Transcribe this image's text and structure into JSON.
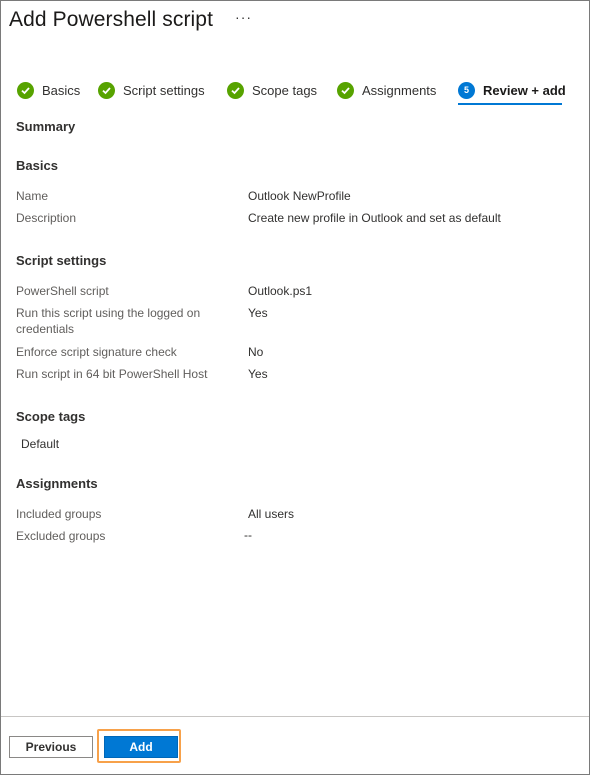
{
  "header": {
    "title": "Add Powershell script",
    "more_label": "···"
  },
  "steps": [
    {
      "label": "Basics",
      "status": "complete"
    },
    {
      "label": "Script settings",
      "status": "complete"
    },
    {
      "label": "Scope tags",
      "status": "complete"
    },
    {
      "label": "Assignments",
      "status": "complete"
    },
    {
      "label": "Review + add",
      "status": "current",
      "number": "5"
    }
  ],
  "summary": {
    "heading": "Summary"
  },
  "basics": {
    "heading": "Basics",
    "name_label": "Name",
    "name_value": "Outlook NewProfile",
    "description_label": "Description",
    "description_value": "Create new profile in Outlook and set as default"
  },
  "script_settings": {
    "heading": "Script settings",
    "script_label": "PowerShell script",
    "script_value": "Outlook.ps1",
    "logged_on_label_line1": "Run this script using the logged on",
    "logged_on_label_line2": "credentials",
    "logged_on_value": "Yes",
    "signature_label": "Enforce script signature check",
    "signature_value": "No",
    "host64_label": "Run script in 64 bit PowerShell Host",
    "host64_value": "Yes"
  },
  "scope_tags": {
    "heading": "Scope tags",
    "value": "Default"
  },
  "assignments": {
    "heading": "Assignments",
    "included_label": "Included groups",
    "included_value": "All users",
    "excluded_label": "Excluded groups",
    "excluded_value": "--"
  },
  "footer": {
    "previous_label": "Previous",
    "add_label": "Add"
  },
  "colors": {
    "accent": "#0078d4",
    "complete": "#57a300",
    "highlight": "#f7a14a"
  },
  "icons": {
    "complete": "check-circle-icon",
    "current": "step-number-icon"
  }
}
